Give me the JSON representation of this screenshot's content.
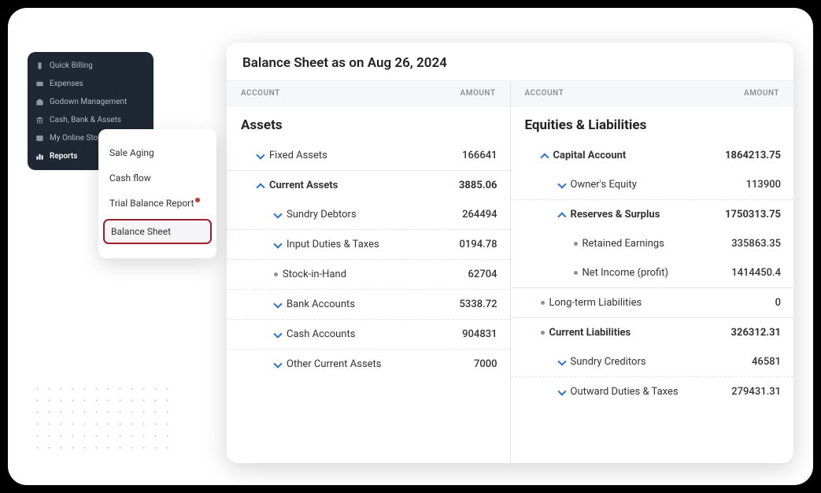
{
  "sidebar": {
    "items": [
      {
        "label": "Quick Billing"
      },
      {
        "label": "Expenses"
      },
      {
        "label": "Godown Management"
      },
      {
        "label": "Cash, Bank & Assets"
      },
      {
        "label": "My Online Store"
      },
      {
        "label": "Reports"
      }
    ]
  },
  "submenu": {
    "items": [
      {
        "label": "Sale Aging"
      },
      {
        "label": "Cash flow"
      },
      {
        "label": "Trial Balance Report"
      },
      {
        "label": "Balance Sheet"
      }
    ]
  },
  "panel": {
    "title": "Balance Sheet as on Aug 26, 2024",
    "header_account": "ACCOUNT",
    "header_amount": "AMOUNT",
    "left": {
      "section": "Assets",
      "rows": [
        {
          "label": "Fixed Assets",
          "amount": "166641"
        },
        {
          "label": "Current Assets",
          "amount": "3885.06"
        },
        {
          "label": "Sundry Debtors",
          "amount": "264494"
        },
        {
          "label": "Input Duties & Taxes",
          "amount": "0194.78"
        },
        {
          "label": "Stock-in-Hand",
          "amount": "62704"
        },
        {
          "label": "Bank Accounts",
          "amount": "5338.72"
        },
        {
          "label": "Cash Accounts",
          "amount": "904831"
        },
        {
          "label": "Other Current Assets",
          "amount": "7000"
        }
      ]
    },
    "right": {
      "section": "Equities & Liabilities",
      "rows": [
        {
          "label": "Capital Account",
          "amount": "1864213.75"
        },
        {
          "label": "Owner's Equity",
          "amount": "113900"
        },
        {
          "label": "Reserves & Surplus",
          "amount": "1750313.75"
        },
        {
          "label": "Retained Earnings",
          "amount": "335863.35"
        },
        {
          "label": "Net Income (profit)",
          "amount": "1414450.4"
        },
        {
          "label": "Long-term Liabilities",
          "amount": "0"
        },
        {
          "label": "Current Liabilities",
          "amount": "326312.31"
        },
        {
          "label": "Sundry Creditors",
          "amount": "46581"
        },
        {
          "label": "Outward Duties & Taxes",
          "amount": "279431.31"
        }
      ]
    }
  }
}
